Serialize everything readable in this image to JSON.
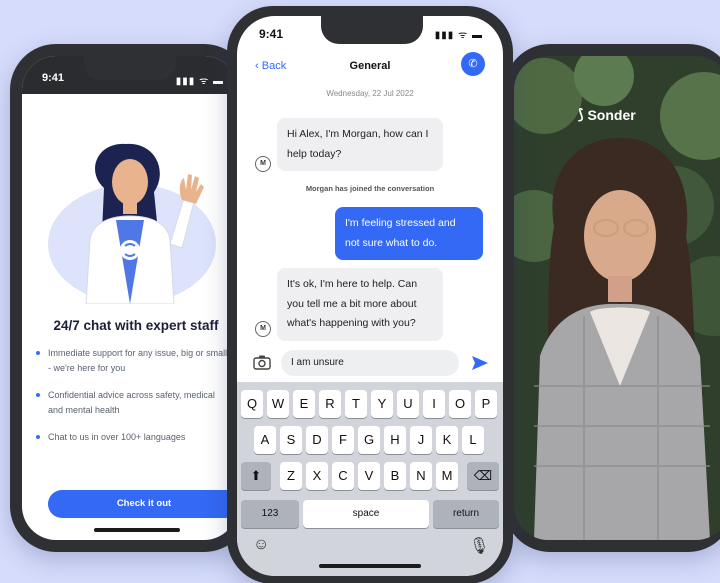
{
  "left_phone": {
    "time": "9:41",
    "status_icons": "▮▮▮ ᯤ ▬",
    "headline": "24/7 chat with expert staff",
    "bullets": [
      "Immediate support for any issue, big or small - we're here for you",
      "Confidential advice across safety, medical and mental health",
      "Chat to us in over 100+ languages"
    ],
    "cta_label": "Check it out"
  },
  "center_phone": {
    "time": "9:41",
    "status_icons": "▮▮▮ ᯤ ▬",
    "back_label": "Back",
    "title": "General",
    "call_icon": "phone-icon",
    "date_label": "Wednesday, 22 Jul 2022",
    "messages": [
      {
        "from": "agent",
        "avatar": "M",
        "text": "Hi Alex, I'm Morgan, how can I help today?"
      },
      {
        "system": "Morgan has joined the conversation"
      },
      {
        "from": "user",
        "text": "I'm feeling stressed and not sure what to do."
      },
      {
        "from": "agent",
        "avatar": "M",
        "text": "It's ok, I'm here to help. Can you tell me a bit more about what's happening with you?"
      }
    ],
    "composer_value": "I am unsure",
    "keyboard": {
      "row1": [
        "Q",
        "W",
        "E",
        "R",
        "T",
        "Y",
        "U",
        "I",
        "O",
        "P"
      ],
      "row2": [
        "A",
        "S",
        "D",
        "F",
        "G",
        "H",
        "J",
        "K",
        "L"
      ],
      "row3": [
        "Z",
        "X",
        "C",
        "V",
        "B",
        "N",
        "M"
      ],
      "numbers_key": "123",
      "space_key": "space",
      "return_key": "return"
    }
  },
  "right_phone": {
    "brand": "Sonder"
  },
  "colors": {
    "accent": "#3369f4",
    "background": "#d6dcfb"
  }
}
